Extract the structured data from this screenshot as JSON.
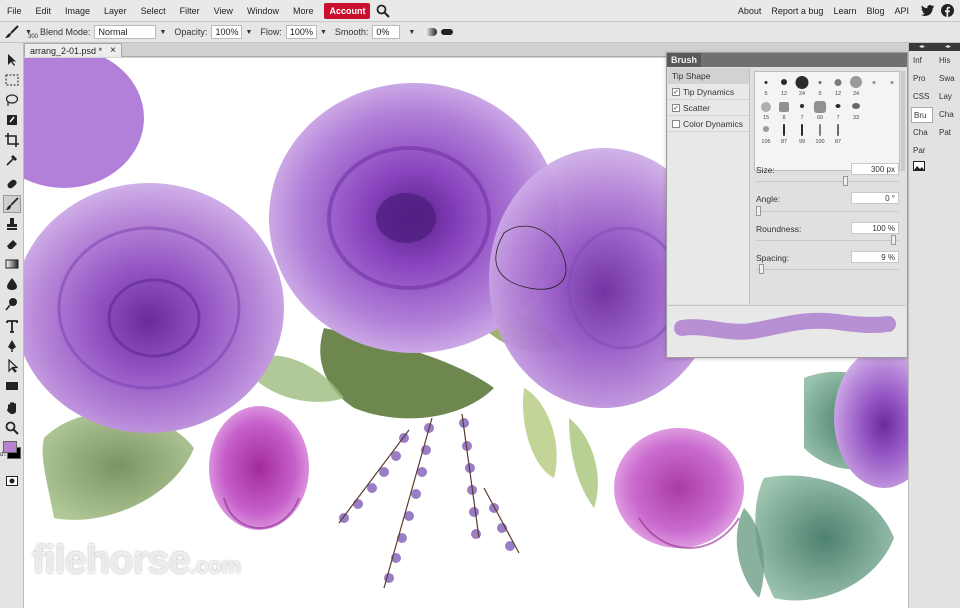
{
  "menubar": {
    "items": [
      "File",
      "Edit",
      "Image",
      "Layer",
      "Select",
      "Filter",
      "View",
      "Window",
      "More"
    ],
    "account_label": "Account",
    "right_items": [
      "About",
      "Report a bug",
      "Learn",
      "Blog",
      "API"
    ]
  },
  "options": {
    "brush_size": "300",
    "blend_mode_label": "Blend Mode:",
    "blend_mode_value": "Normal",
    "opacity_label": "Opacity:",
    "opacity_value": "100%",
    "flow_label": "Flow:",
    "flow_value": "100%",
    "smooth_label": "Smooth:",
    "smooth_value": "0%"
  },
  "document_tab": {
    "title": "arrang_2-01.psd *",
    "close": "×"
  },
  "right_panel": {
    "col1": [
      "Inf",
      "Pro",
      "CSS",
      "Bru",
      "Cha",
      "Par"
    ],
    "col2": [
      "His",
      "Swa",
      "Lay",
      "Cha",
      "Pat"
    ],
    "col1_selected": "Bru"
  },
  "brush_panel": {
    "title": "Brush",
    "sections": [
      {
        "label": "Tip Shape",
        "checkbox": false,
        "checked": false
      },
      {
        "label": "Tip Dynamics",
        "checkbox": true,
        "checked": true
      },
      {
        "label": "Scatter",
        "checkbox": true,
        "checked": true
      },
      {
        "label": "Color Dynamics",
        "checkbox": true,
        "checked": false
      }
    ],
    "presets_row1": [
      "5",
      "12",
      "24",
      "5",
      "12",
      "24"
    ],
    "presets_row2": [
      "15",
      "8",
      "7",
      "60",
      "7",
      "33"
    ],
    "presets_row3": [
      "105",
      "87",
      "99",
      "100",
      "87"
    ],
    "size_label": "Size:",
    "size_value": "300 px",
    "angle_label": "Angle:",
    "angle_value": "0 °",
    "roundness_label": "Roundness:",
    "roundness_value": "100 %",
    "spacing_label": "Spacing:",
    "spacing_value": "9 %",
    "stroke_color": "#b690d3"
  },
  "colors": {
    "foreground": "#b584cf",
    "background": "#000000",
    "accent": "#c8102e"
  },
  "watermark": {
    "text": "filehorse",
    "suffix": ".com"
  }
}
